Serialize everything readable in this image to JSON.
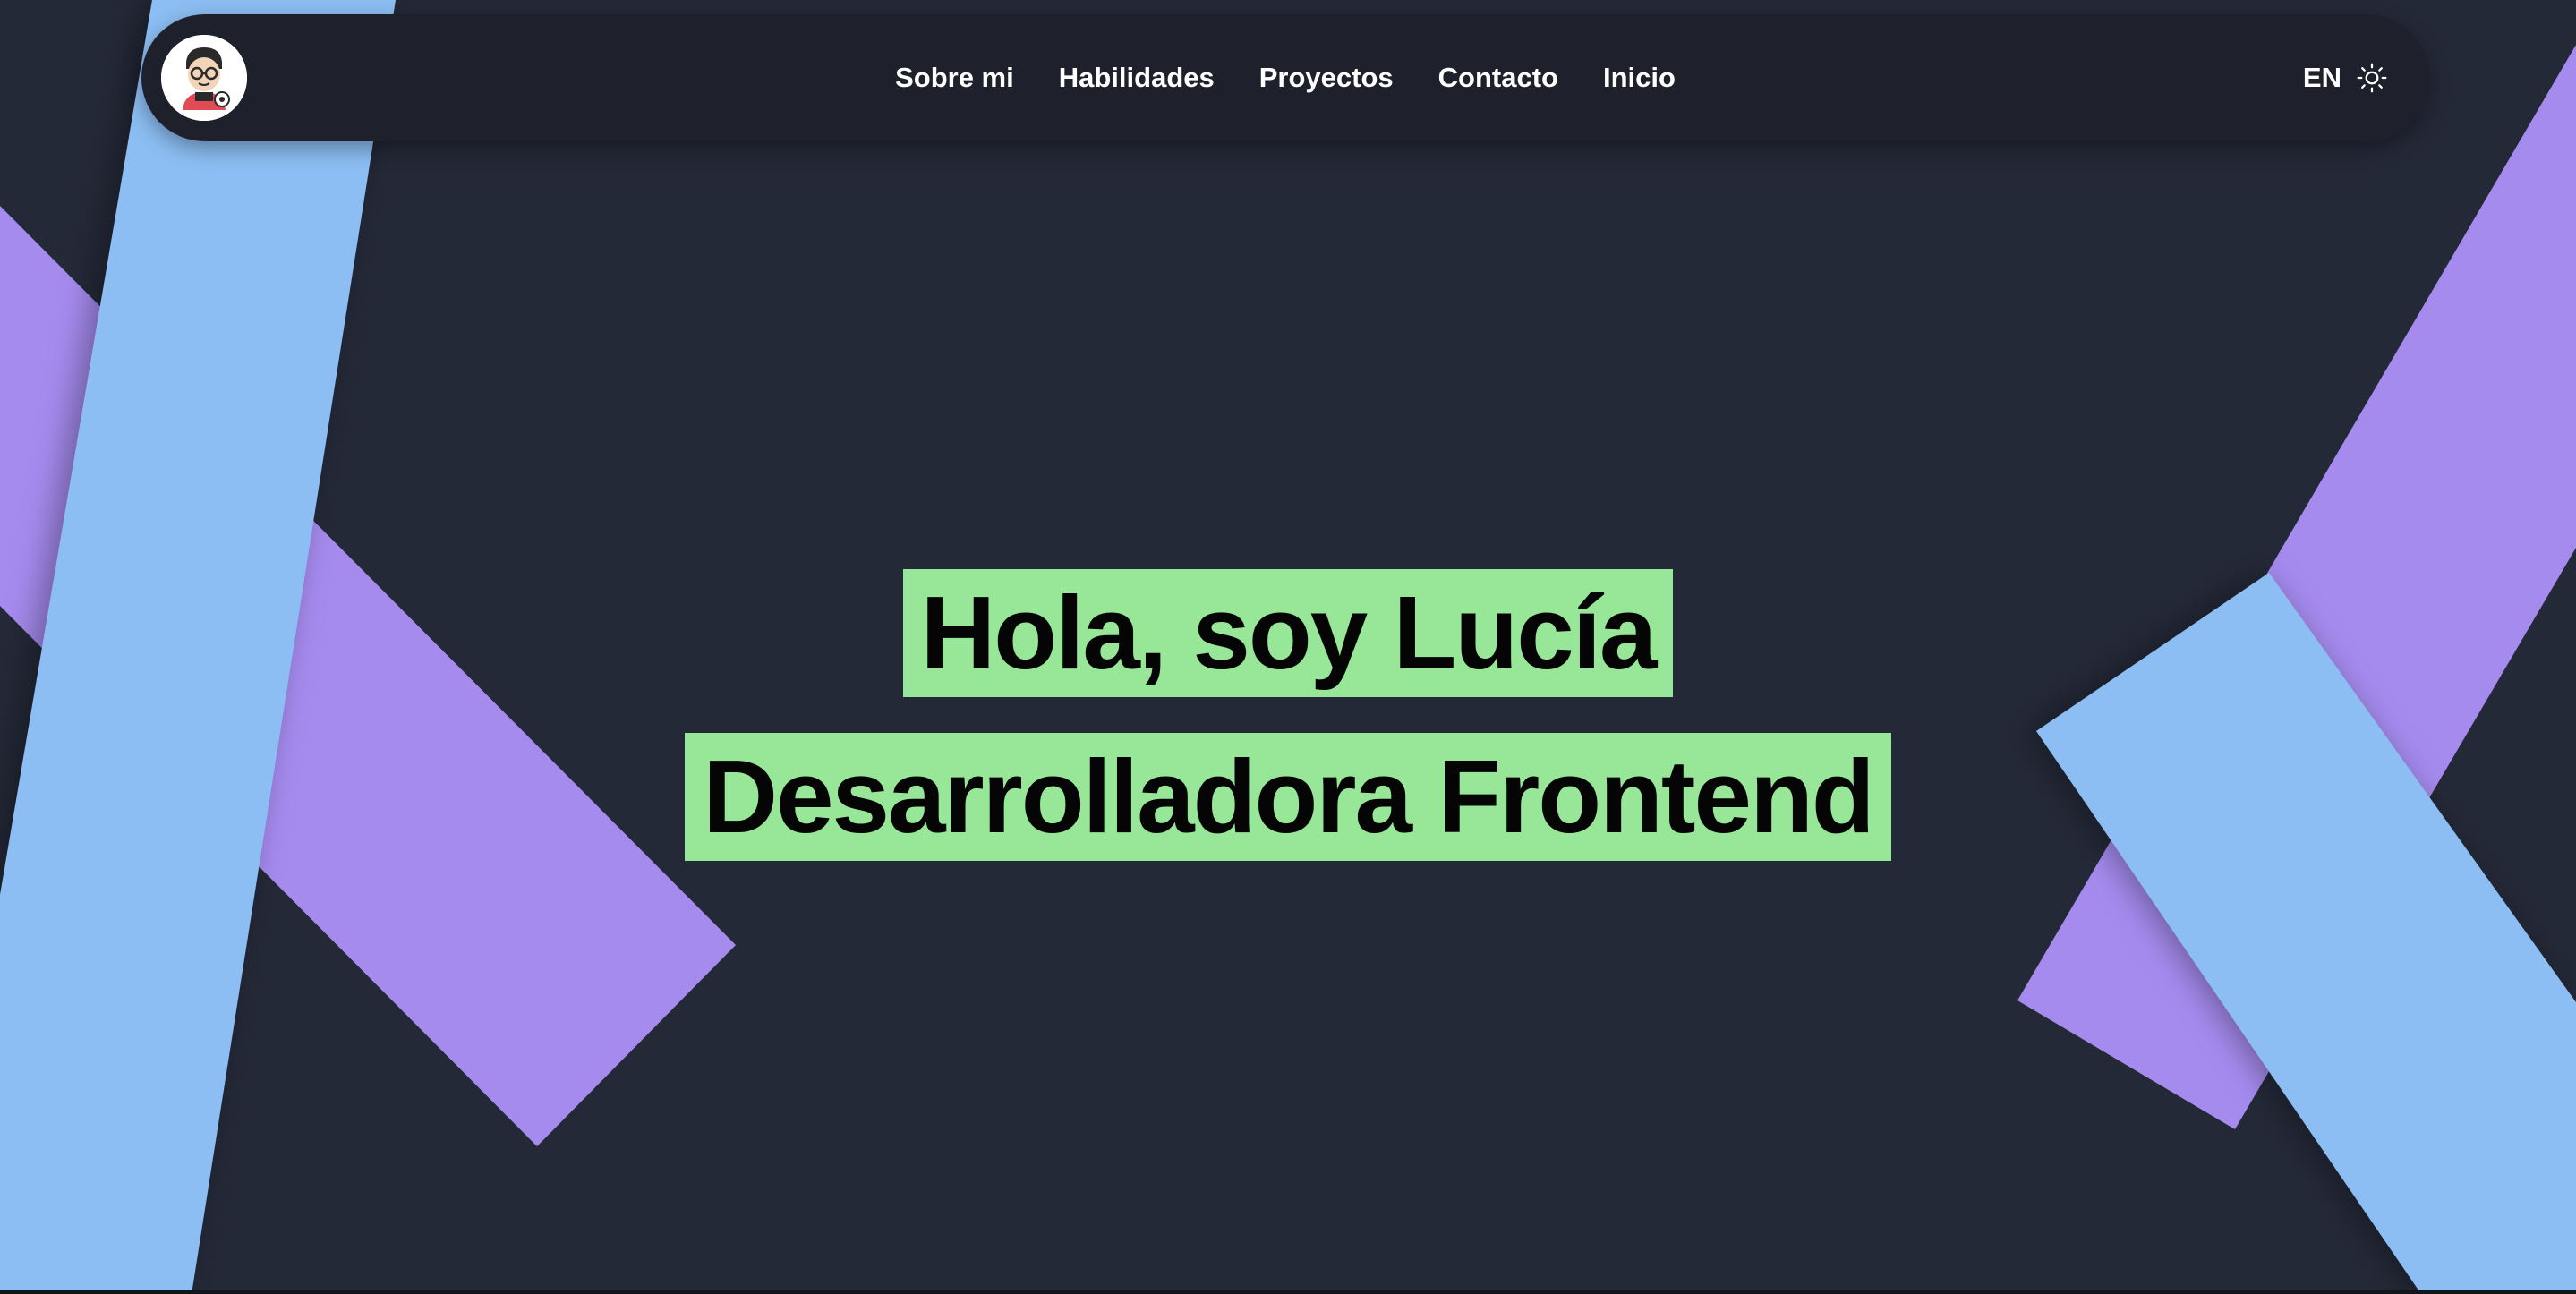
{
  "colors": {
    "background": "#242938",
    "navbar": "#1e212b",
    "blue_band": "#8cbef3",
    "purple_band": "#a68bef",
    "highlight": "#98e697",
    "text_light": "#ffffff",
    "text_dark": "#050505"
  },
  "navbar": {
    "avatar_icon": "cartoon-avatar-icon",
    "links": [
      {
        "label": "Sobre mi"
      },
      {
        "label": "Habilidades"
      },
      {
        "label": "Proyectos"
      },
      {
        "label": "Contacto"
      },
      {
        "label": "Inicio"
      }
    ],
    "language_label": "EN",
    "theme_icon": "sun-icon"
  },
  "hero": {
    "greeting": "Hola, soy Lucía",
    "role": "Desarrolladora Frontend"
  }
}
